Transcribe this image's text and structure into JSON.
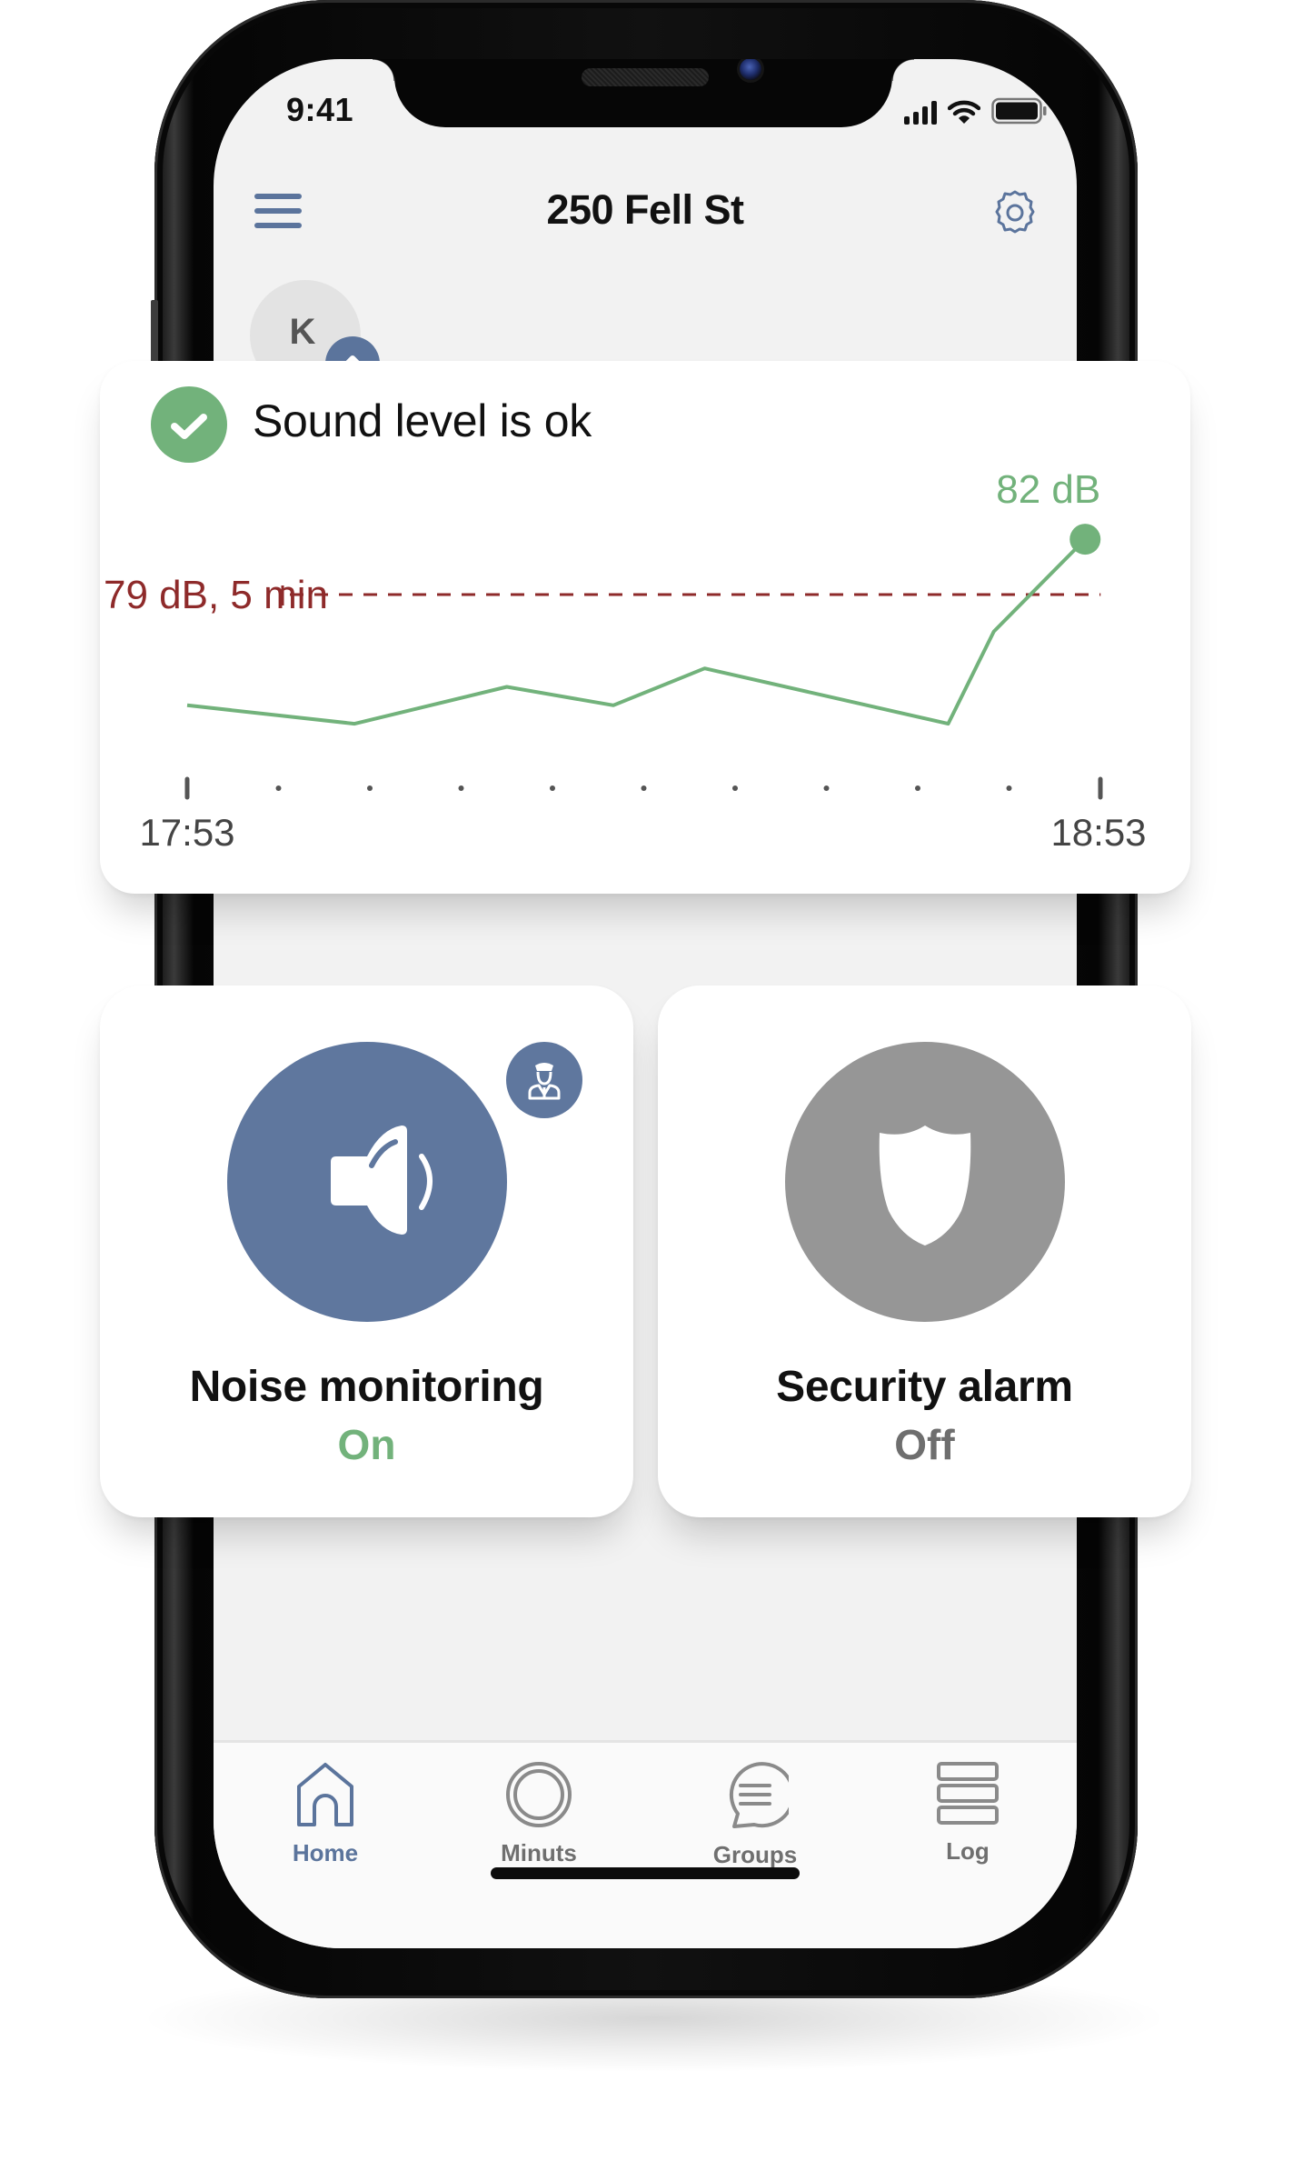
{
  "status_bar": {
    "time": "9:41",
    "icons": [
      "cellular-signal-icon",
      "wifi-icon",
      "battery-icon"
    ]
  },
  "header": {
    "menu_icon": "hamburger-menu-icon",
    "title": "250 Fell St",
    "settings_icon": "gear-icon"
  },
  "avatar": {
    "initial": "K",
    "badge_icon": "chevron-up-icon"
  },
  "sound_card": {
    "status_icon": "check-circle-icon",
    "status_text": "Sound level is ok",
    "threshold_label": "79 dB, 5 min",
    "current_label": "82 dB"
  },
  "chart_data": {
    "type": "line",
    "title": "Sound level is ok",
    "xlabel": "",
    "ylabel": "dB",
    "x_unit": "minutes since 17:53",
    "x": [
      0,
      11,
      21,
      28,
      34,
      50,
      53,
      59
    ],
    "series": [
      {
        "name": "Sound level (dB)",
        "values": [
          73,
          72,
          74,
          73,
          75,
          72,
          77,
          82
        ]
      }
    ],
    "xlim": [
      0,
      60
    ],
    "ylim": [
      68,
      84
    ],
    "x_tick_labels": [
      "17:53",
      "18:53"
    ],
    "minor_ticks": 9,
    "threshold": {
      "value": 79,
      "label": "79 dB, 5 min",
      "style": "dashed"
    },
    "last_point_label": "82 dB",
    "grid": false,
    "legend": "none",
    "colors": {
      "line": "#72b27b",
      "threshold": "#8e2a2a",
      "axis": "#555555"
    }
  },
  "tiles": [
    {
      "name": "noise-monitoring",
      "icon": "speaker-icon",
      "badge_icon": "security-guard-icon",
      "title": "Noise monitoring",
      "state": "On",
      "circle_color": "#5f779e",
      "state_color": "#72b27b"
    },
    {
      "name": "security-alarm",
      "icon": "shield-icon",
      "title": "Security alarm",
      "state": "Off",
      "circle_color": "#969696",
      "state_color": "#6e6e6e"
    }
  ],
  "bottom_nav": {
    "active": "Home",
    "items": [
      {
        "label": "Home",
        "icon": "home-icon"
      },
      {
        "label": "Minuts",
        "icon": "minuts-ring-icon"
      },
      {
        "label": "Groups",
        "icon": "chat-bubble-icon"
      },
      {
        "label": "Log",
        "icon": "log-list-icon"
      }
    ]
  },
  "colors": {
    "brand_blue": "#5b749c",
    "ok_green": "#72b27b",
    "alert_red": "#8e2a2a",
    "inactive_grey": "#969696"
  }
}
